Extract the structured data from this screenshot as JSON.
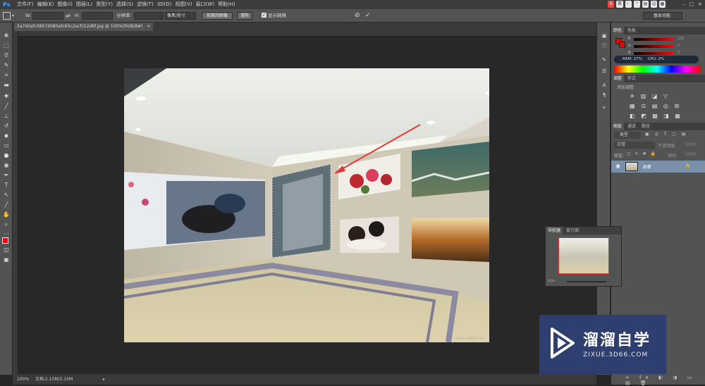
{
  "app": {
    "logo": "Ps"
  },
  "menu": [
    "文件(F)",
    "编辑(E)",
    "图像(I)",
    "图层(L)",
    "类型(Y)",
    "选择(S)",
    "滤镜(T)",
    "3D(D)",
    "视图(V)",
    "窗口(W)",
    "帮助(H)"
  ],
  "ime": {
    "label": "英"
  },
  "workspace_preset": "基本功能",
  "options": {
    "w_label": "W:",
    "h_label": "H:",
    "resolution_label": "分辨率:",
    "unit_select": "像素/英寸",
    "front_image_btn": "前面的图像",
    "clear_btn": "清除",
    "show_grid_label": "显示网格",
    "show_grid_checked": true
  },
  "tab": {
    "title": "2a740afc08574083afc65c2acfc52d6f.jpg @ 100%(RGB/8#)",
    "close": "×"
  },
  "status": {
    "zoom": "100%",
    "doc": "文档:2.15M/2.15M"
  },
  "color_panel": {
    "tabs": [
      "颜色",
      "色板"
    ],
    "r": "230",
    "g": "5",
    "b": "5",
    "ram": "RAM: 27%",
    "cpu": "CPU: 2%"
  },
  "adjust_panel": {
    "tabs": [
      "调整",
      "样式"
    ],
    "add_label": "添加调整"
  },
  "layers_panel": {
    "tabs": [
      "图层",
      "通道",
      "路径"
    ],
    "kind_select": "类型",
    "blend_select": "正常",
    "opacity_label": "不透明度:",
    "opacity_value": "100%",
    "lock_label": "锁定:",
    "fill_label": "填充:",
    "fill_value": "100%",
    "layer_name": "背景"
  },
  "navigator": {
    "tabs": [
      "导航器",
      "直方图"
    ],
    "zoom": "100%"
  },
  "canvas_watermark": "zixue.3d66.com",
  "watermark": {
    "cn": "溜溜自学",
    "en": "ZIXUE.3D66.COM"
  },
  "colors": {
    "accent": "#31a8ff",
    "red": "#e60505",
    "panel": "#535353",
    "dark": "#262626"
  }
}
